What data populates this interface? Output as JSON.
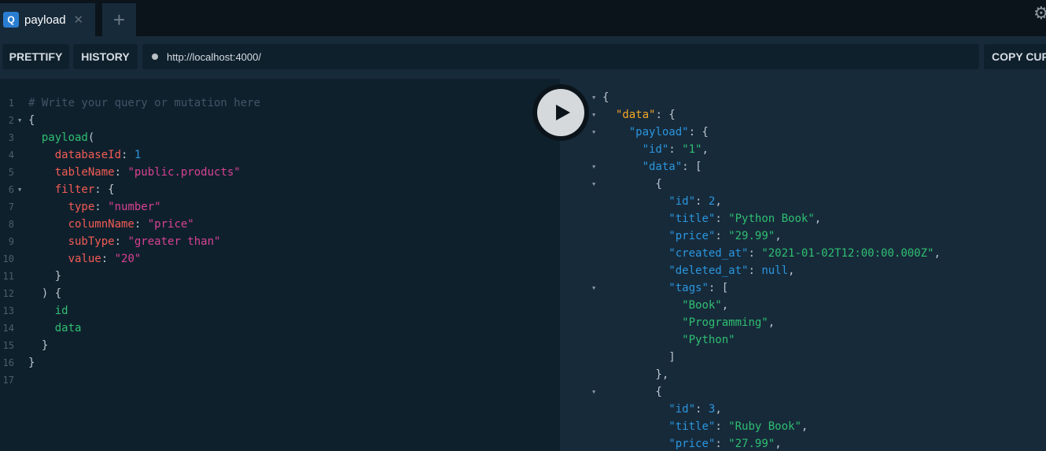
{
  "tab": {
    "icon_letter": "Q",
    "label": "payload",
    "close_glyph": "✕",
    "add_glyph": "+"
  },
  "toolbar": {
    "prettify_label": "PRETTIFY",
    "history_label": "HISTORY",
    "endpoint_url": "http://localhost:4000/",
    "copy_label": "COPY CURL"
  },
  "icons": {
    "settings": "gear-icon",
    "run": "play-icon",
    "fold": "triangle-down-icon"
  },
  "colors": {
    "background": "#0b141a",
    "editor_bg": "#0f202d",
    "panel_bg": "#172a3a",
    "string": "#d64292",
    "field": "#2fbf71",
    "argument": "#f25c54",
    "number": "#2b96de",
    "top_key": "#f5a623"
  },
  "query_lines": [
    {
      "num": "1",
      "fold": false,
      "tokens": [
        {
          "t": "# Write your query or mutation here",
          "c": "cm"
        }
      ]
    },
    {
      "num": "2",
      "fold": true,
      "tokens": [
        {
          "t": "{",
          "c": "pn"
        }
      ]
    },
    {
      "num": "3",
      "fold": false,
      "tokens": [
        {
          "t": "  ",
          "c": "pn"
        },
        {
          "t": "payload",
          "c": "fd"
        },
        {
          "t": "(",
          "c": "pn"
        }
      ]
    },
    {
      "num": "4",
      "fold": false,
      "tokens": [
        {
          "t": "    ",
          "c": "pn"
        },
        {
          "t": "databaseId",
          "c": "ar"
        },
        {
          "t": ": ",
          "c": "pn"
        },
        {
          "t": "1",
          "c": "nu"
        }
      ]
    },
    {
      "num": "5",
      "fold": false,
      "tokens": [
        {
          "t": "    ",
          "c": "pn"
        },
        {
          "t": "tableName",
          "c": "ar"
        },
        {
          "t": ": ",
          "c": "pn"
        },
        {
          "t": "\"public.products\"",
          "c": "st"
        }
      ]
    },
    {
      "num": "6",
      "fold": true,
      "tokens": [
        {
          "t": "    ",
          "c": "pn"
        },
        {
          "t": "filter",
          "c": "ar"
        },
        {
          "t": ": {",
          "c": "pn"
        }
      ]
    },
    {
      "num": "7",
      "fold": false,
      "tokens": [
        {
          "t": "      ",
          "c": "pn"
        },
        {
          "t": "type",
          "c": "ar"
        },
        {
          "t": ": ",
          "c": "pn"
        },
        {
          "t": "\"number\"",
          "c": "st"
        }
      ]
    },
    {
      "num": "8",
      "fold": false,
      "tokens": [
        {
          "t": "      ",
          "c": "pn"
        },
        {
          "t": "columnName",
          "c": "ar"
        },
        {
          "t": ": ",
          "c": "pn"
        },
        {
          "t": "\"price\"",
          "c": "st"
        }
      ]
    },
    {
      "num": "9",
      "fold": false,
      "tokens": [
        {
          "t": "      ",
          "c": "pn"
        },
        {
          "t": "subType",
          "c": "ar"
        },
        {
          "t": ": ",
          "c": "pn"
        },
        {
          "t": "\"greater than\"",
          "c": "st"
        }
      ]
    },
    {
      "num": "10",
      "fold": false,
      "tokens": [
        {
          "t": "      ",
          "c": "pn"
        },
        {
          "t": "value",
          "c": "ar"
        },
        {
          "t": ": ",
          "c": "pn"
        },
        {
          "t": "\"20\"",
          "c": "st"
        }
      ]
    },
    {
      "num": "11",
      "fold": false,
      "tokens": [
        {
          "t": "    }",
          "c": "pn"
        }
      ]
    },
    {
      "num": "12",
      "fold": false,
      "tokens": [
        {
          "t": "  ) {",
          "c": "pn"
        }
      ]
    },
    {
      "num": "13",
      "fold": false,
      "tokens": [
        {
          "t": "    ",
          "c": "pn"
        },
        {
          "t": "id",
          "c": "fd"
        }
      ]
    },
    {
      "num": "14",
      "fold": false,
      "tokens": [
        {
          "t": "    ",
          "c": "pn"
        },
        {
          "t": "data",
          "c": "fd"
        }
      ]
    },
    {
      "num": "15",
      "fold": false,
      "tokens": [
        {
          "t": "  }",
          "c": "pn"
        }
      ]
    },
    {
      "num": "16",
      "fold": false,
      "tokens": [
        {
          "t": "}",
          "c": "pn"
        }
      ]
    },
    {
      "num": "17",
      "fold": false,
      "tokens": []
    }
  ],
  "result_lines": [
    {
      "fold": true,
      "tokens": [
        {
          "t": "{",
          "c": "pn"
        }
      ]
    },
    {
      "fold": true,
      "tokens": [
        {
          "t": "  ",
          "c": "pn"
        },
        {
          "t": "\"data\"",
          "c": "k-top"
        },
        {
          "t": ": {",
          "c": "pn"
        }
      ]
    },
    {
      "fold": true,
      "tokens": [
        {
          "t": "    ",
          "c": "pn"
        },
        {
          "t": "\"payload\"",
          "c": "k"
        },
        {
          "t": ": {",
          "c": "pn"
        }
      ]
    },
    {
      "fold": false,
      "tokens": [
        {
          "t": "      ",
          "c": "pn"
        },
        {
          "t": "\"id\"",
          "c": "k"
        },
        {
          "t": ": ",
          "c": "pn"
        },
        {
          "t": "\"1\"",
          "c": "sv"
        },
        {
          "t": ",",
          "c": "pn"
        }
      ]
    },
    {
      "fold": true,
      "tokens": [
        {
          "t": "      ",
          "c": "pn"
        },
        {
          "t": "\"data\"",
          "c": "k"
        },
        {
          "t": ": [",
          "c": "pn"
        }
      ]
    },
    {
      "fold": true,
      "tokens": [
        {
          "t": "        {",
          "c": "pn"
        }
      ]
    },
    {
      "fold": false,
      "tokens": [
        {
          "t": "          ",
          "c": "pn"
        },
        {
          "t": "\"id\"",
          "c": "k"
        },
        {
          "t": ": ",
          "c": "pn"
        },
        {
          "t": "2",
          "c": "nv"
        },
        {
          "t": ",",
          "c": "pn"
        }
      ]
    },
    {
      "fold": false,
      "tokens": [
        {
          "t": "          ",
          "c": "pn"
        },
        {
          "t": "\"title\"",
          "c": "k"
        },
        {
          "t": ": ",
          "c": "pn"
        },
        {
          "t": "\"Python Book\"",
          "c": "sv"
        },
        {
          "t": ",",
          "c": "pn"
        }
      ]
    },
    {
      "fold": false,
      "tokens": [
        {
          "t": "          ",
          "c": "pn"
        },
        {
          "t": "\"price\"",
          "c": "k"
        },
        {
          "t": ": ",
          "c": "pn"
        },
        {
          "t": "\"29.99\"",
          "c": "sv"
        },
        {
          "t": ",",
          "c": "pn"
        }
      ]
    },
    {
      "fold": false,
      "tokens": [
        {
          "t": "          ",
          "c": "pn"
        },
        {
          "t": "\"created_at\"",
          "c": "k"
        },
        {
          "t": ": ",
          "c": "pn"
        },
        {
          "t": "\"2021-01-02T12:00:00.000Z\"",
          "c": "sv"
        },
        {
          "t": ",",
          "c": "pn"
        }
      ]
    },
    {
      "fold": false,
      "tokens": [
        {
          "t": "          ",
          "c": "pn"
        },
        {
          "t": "\"deleted_at\"",
          "c": "k"
        },
        {
          "t": ": ",
          "c": "pn"
        },
        {
          "t": "null",
          "c": "nv"
        },
        {
          "t": ",",
          "c": "pn"
        }
      ]
    },
    {
      "fold": true,
      "tokens": [
        {
          "t": "          ",
          "c": "pn"
        },
        {
          "t": "\"tags\"",
          "c": "k"
        },
        {
          "t": ": [",
          "c": "pn"
        }
      ]
    },
    {
      "fold": false,
      "tokens": [
        {
          "t": "            ",
          "c": "pn"
        },
        {
          "t": "\"Book\"",
          "c": "sv"
        },
        {
          "t": ",",
          "c": "pn"
        }
      ]
    },
    {
      "fold": false,
      "tokens": [
        {
          "t": "            ",
          "c": "pn"
        },
        {
          "t": "\"Programming\"",
          "c": "sv"
        },
        {
          "t": ",",
          "c": "pn"
        }
      ]
    },
    {
      "fold": false,
      "tokens": [
        {
          "t": "            ",
          "c": "pn"
        },
        {
          "t": "\"Python\"",
          "c": "sv"
        }
      ]
    },
    {
      "fold": false,
      "tokens": [
        {
          "t": "          ]",
          "c": "pn"
        }
      ]
    },
    {
      "fold": false,
      "tokens": [
        {
          "t": "        },",
          "c": "pn"
        }
      ]
    },
    {
      "fold": true,
      "tokens": [
        {
          "t": "        {",
          "c": "pn"
        }
      ]
    },
    {
      "fold": false,
      "tokens": [
        {
          "t": "          ",
          "c": "pn"
        },
        {
          "t": "\"id\"",
          "c": "k"
        },
        {
          "t": ": ",
          "c": "pn"
        },
        {
          "t": "3",
          "c": "nv"
        },
        {
          "t": ",",
          "c": "pn"
        }
      ]
    },
    {
      "fold": false,
      "tokens": [
        {
          "t": "          ",
          "c": "pn"
        },
        {
          "t": "\"title\"",
          "c": "k"
        },
        {
          "t": ": ",
          "c": "pn"
        },
        {
          "t": "\"Ruby Book\"",
          "c": "sv"
        },
        {
          "t": ",",
          "c": "pn"
        }
      ]
    },
    {
      "fold": false,
      "tokens": [
        {
          "t": "          ",
          "c": "pn"
        },
        {
          "t": "\"price\"",
          "c": "k"
        },
        {
          "t": ": ",
          "c": "pn"
        },
        {
          "t": "\"27.99\"",
          "c": "sv"
        },
        {
          "t": ",",
          "c": "pn"
        }
      ]
    }
  ]
}
